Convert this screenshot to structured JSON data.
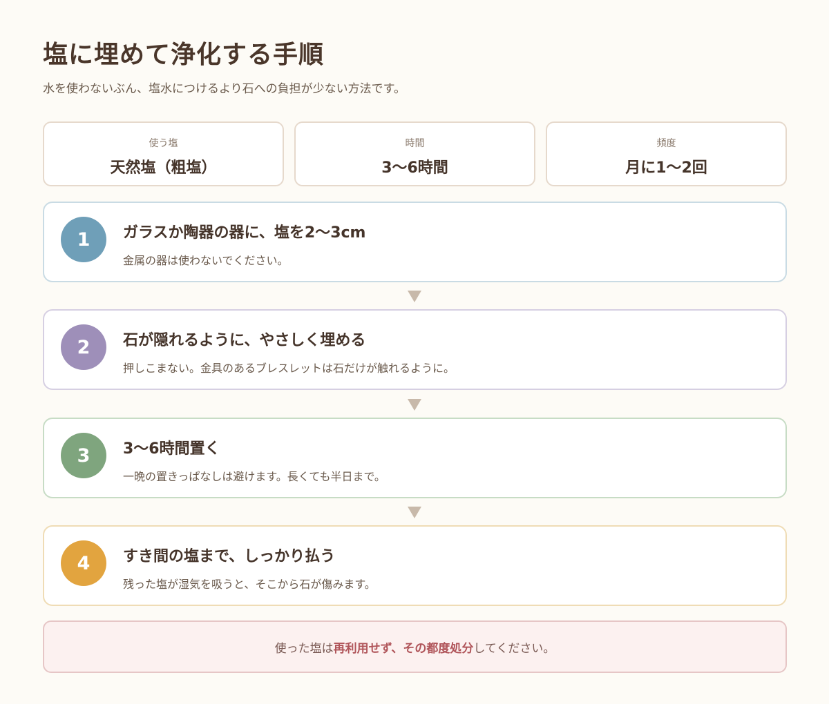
{
  "header": {
    "title": "塩に埋めて浄化する手順",
    "subtitle": "水を使わないぶん、塩水につけるより石への負担が少ない方法です。"
  },
  "info": [
    {
      "label": "使う塩",
      "value": "天然塩（粗塩）"
    },
    {
      "label": "時間",
      "value": "3〜6時間"
    },
    {
      "label": "頻度",
      "value": "月に1〜2回"
    }
  ],
  "steps": [
    {
      "number": "1",
      "title": "ガラスか陶器の器に、塩を2〜3cm",
      "desc": "金属の器は使わないでください。",
      "color": "#6f9fb8",
      "border": "#c9dbe4"
    },
    {
      "number": "2",
      "title": "石が隠れるように、やさしく埋める",
      "desc": "押しこまない。金具のあるブレスレットは石だけが触れるように。",
      "color": "#9e8fb9",
      "border": "#d6cfe2"
    },
    {
      "number": "3",
      "title": "3〜6時間置く",
      "desc": "一晩の置きっぱなしは避けます。長くても半日まで。",
      "color": "#7fa57e",
      "border": "#c7dcc5"
    },
    {
      "number": "4",
      "title": "すき間の塩まで、しっかり払う",
      "desc": "残った塩が湿気を吸うと、そこから石が傷みます。",
      "color": "#e2a43f",
      "border": "#efdcb5"
    }
  ],
  "note": {
    "before": "使った塩は",
    "emphasis": "再利用せず、その都度処分",
    "after": "してください。"
  }
}
